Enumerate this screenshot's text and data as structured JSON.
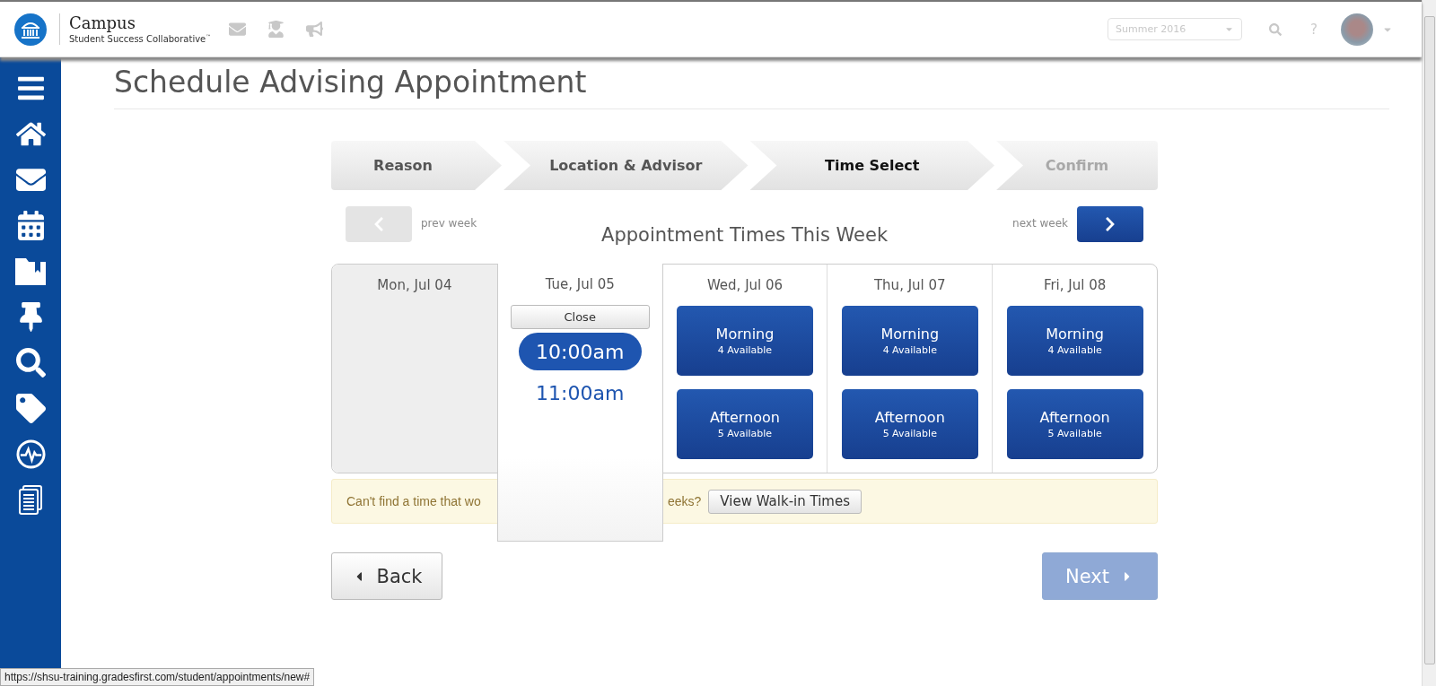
{
  "header": {
    "brand_title": "Campus",
    "brand_subtitle": "Student Success Collaborative$^{™}$",
    "term_select": {
      "value": "Summer 2016"
    },
    "help_label": "?"
  },
  "page": {
    "title": "Schedule Advising Appointment"
  },
  "steps": [
    {
      "label": "Reason",
      "selected": false,
      "disabled": false
    },
    {
      "label": "Location & Advisor",
      "selected": false,
      "disabled": false
    },
    {
      "label": "Time Select",
      "selected": true,
      "disabled": false
    },
    {
      "label": "Confirm",
      "selected": false,
      "disabled": true
    }
  ],
  "week_nav": {
    "prev_label": "prev week",
    "prev_disabled": true,
    "heading": "Appointment Times This Week",
    "next_label": "next week",
    "next_disabled": false
  },
  "days": [
    {
      "label": "Mon, Jul 04",
      "kind": "unavailable"
    },
    {
      "label": "Tue, Jul 05",
      "kind": "times",
      "close_label": "Close",
      "times": [
        {
          "label": "10:00am",
          "selected": true
        },
        {
          "label": "11:00am",
          "selected": false
        }
      ]
    },
    {
      "label": "Wed, Jul 06",
      "kind": "slots",
      "slots": [
        {
          "label": "Morning",
          "count": "4 Available"
        },
        {
          "label": "Afternoon",
          "count": "5 Available"
        }
      ]
    },
    {
      "label": "Thu, Jul 07",
      "kind": "slots",
      "slots": [
        {
          "label": "Morning",
          "count": "4 Available"
        },
        {
          "label": "Afternoon",
          "count": "5 Available"
        }
      ]
    },
    {
      "label": "Fri, Jul 08",
      "kind": "slots",
      "slots": [
        {
          "label": "Morning",
          "count": "4 Available"
        },
        {
          "label": "Afternoon",
          "count": "5 Available"
        }
      ]
    }
  ],
  "notice": {
    "text_start": "Can't find a time that wo",
    "text_end": "eeks?",
    "button": "View Walk-in Times"
  },
  "actions": {
    "back": {
      "label": "Back",
      "disabled": false
    },
    "next": {
      "label": "Next",
      "disabled": true
    }
  },
  "status_bar": {
    "url": "https://shsu-training.gradesfirst.com/student/appointments/new#"
  }
}
